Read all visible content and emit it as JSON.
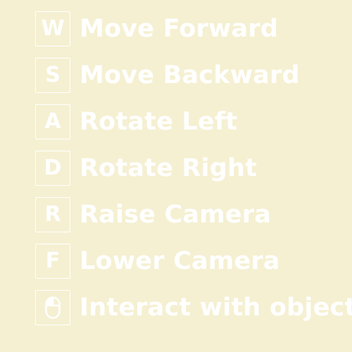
{
  "controls": [
    {
      "key": "W",
      "action": "Move Forward"
    },
    {
      "key": "S",
      "action": "Move Backward"
    },
    {
      "key": "A",
      "action": "Rotate Left"
    },
    {
      "key": "D",
      "action": "Rotate Right"
    },
    {
      "key": "R",
      "action": "Raise Camera"
    },
    {
      "key": "F",
      "action": "Lower Camera"
    },
    {
      "key_icon": "mouse-icon",
      "action": "Interact with object"
    }
  ],
  "colors": {
    "background": "#f5f0d2",
    "foreground": "#ffffff"
  }
}
